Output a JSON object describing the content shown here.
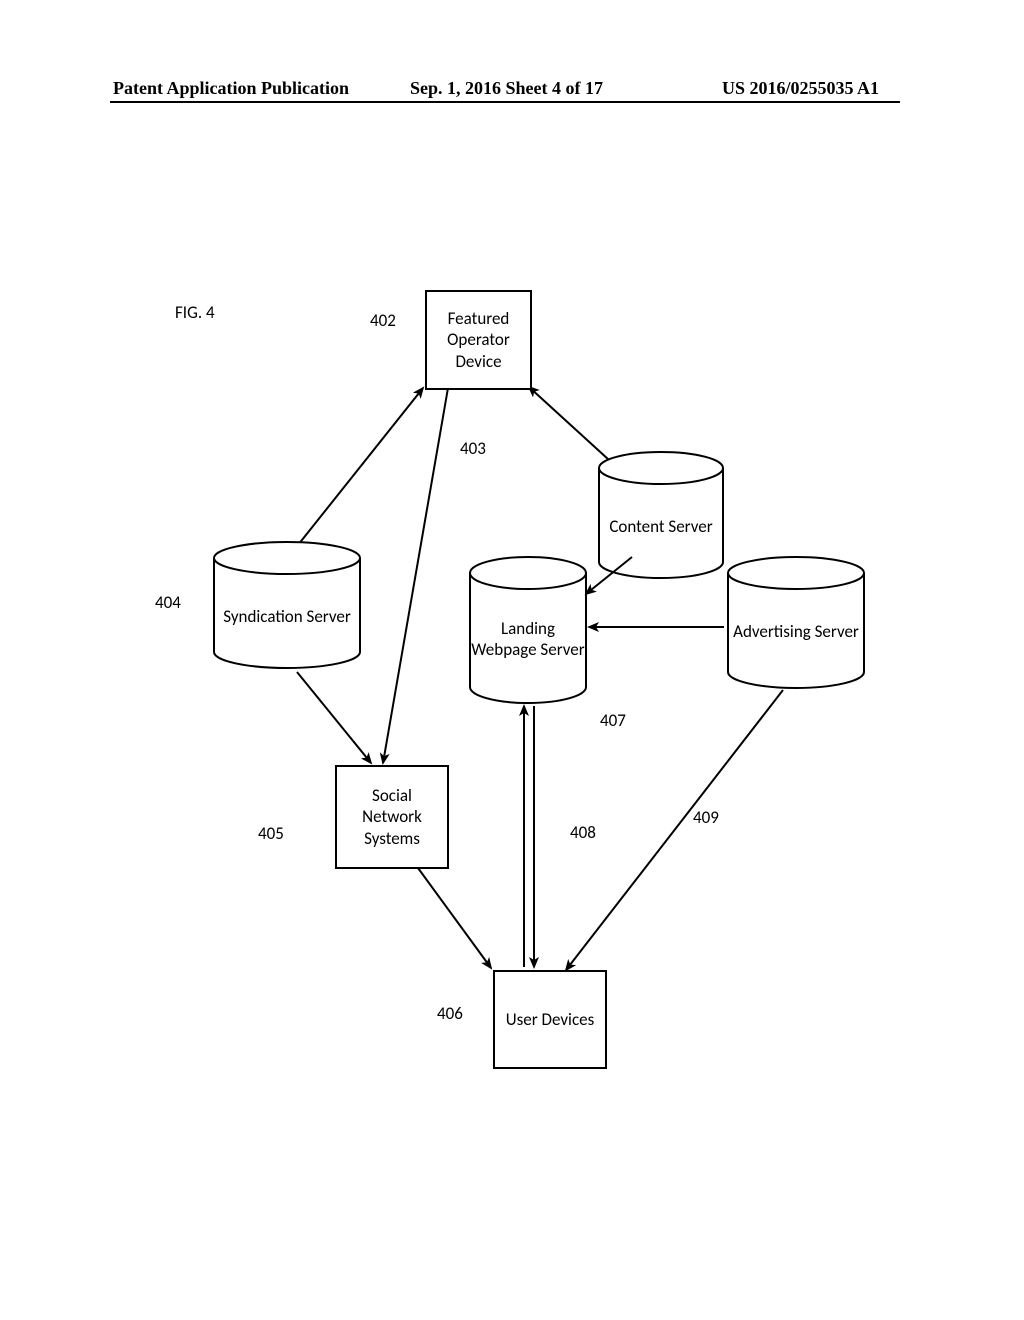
{
  "header": {
    "left": "Patent Application Publication",
    "center": "Sep. 1, 2016  Sheet 4 of 17",
    "right": "US 2016/0255035 A1"
  },
  "figure_label": "FIG. 4",
  "nodes": {
    "featured_operator": {
      "ref": "402",
      "label": "Featured Operator Device"
    },
    "content_server": {
      "ref": "403",
      "label": "Content Server"
    },
    "syndication": {
      "ref": "404",
      "label": "Syndication Server"
    },
    "social_network": {
      "ref": "405",
      "label": "Social Network Systems"
    },
    "user_devices": {
      "ref": "406",
      "label": "User Devices"
    },
    "landing": {
      "ref": "407",
      "label": "Landing Webpage Server"
    },
    "advertising": {
      "ref": "409",
      "label": "Advertising Server"
    },
    "bidir_ref": {
      "ref": "408"
    }
  }
}
